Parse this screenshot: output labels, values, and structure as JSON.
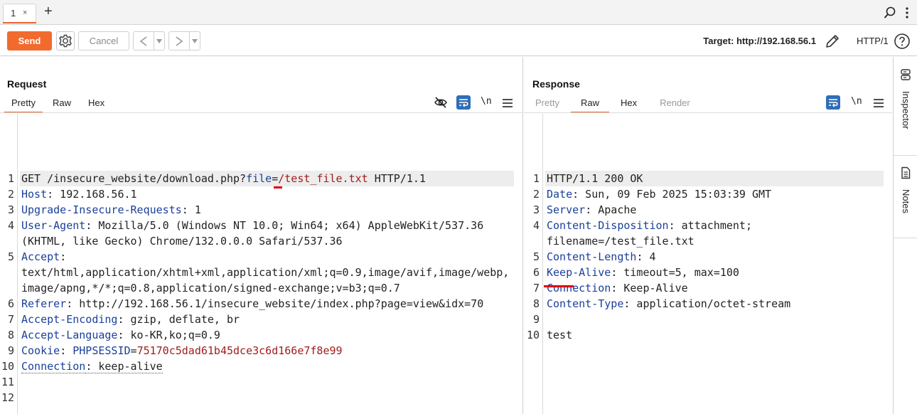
{
  "tabs": [
    {
      "label": "1",
      "close": "×"
    }
  ],
  "new_tab": "+",
  "toolbar": {
    "send_label": "Send",
    "cancel_label": "Cancel",
    "back_label": "<",
    "forward_label": ">",
    "drop_label": "▾",
    "target_label": "Target: http://192.168.56.1",
    "http_version": "HTTP/1"
  },
  "request": {
    "title": "Request",
    "tabs": [
      "Pretty",
      "Raw",
      "Hex"
    ],
    "active_tab": "Pretty",
    "newline_toggle": "\\n",
    "lines": [
      {
        "n": "1",
        "parts": [
          [
            "v",
            "GET /insecure_website/download.php?"
          ],
          [
            "param",
            "file"
          ],
          [
            "v",
            "="
          ],
          [
            "pval",
            "/test_file.txt"
          ],
          [
            "v",
            " HTTP/1.1"
          ]
        ],
        "hl": true
      },
      {
        "n": "2",
        "parts": [
          [
            "k",
            "Host"
          ],
          [
            "v",
            ": 192.168.56.1"
          ]
        ]
      },
      {
        "n": "3",
        "parts": [
          [
            "k",
            "Upgrade-Insecure-Requests"
          ],
          [
            "v",
            ": 1"
          ]
        ]
      },
      {
        "n": "4",
        "parts": [
          [
            "k",
            "User-Agent"
          ],
          [
            "v",
            ": Mozilla/5.0 (Windows NT 10.0; Win64; x64) AppleWebKit/537.36"
          ]
        ]
      },
      {
        "n": "",
        "parts": [
          [
            "v",
            "(KHTML, like Gecko) Chrome/132.0.0.0 Safari/537.36"
          ]
        ]
      },
      {
        "n": "5",
        "parts": [
          [
            "k",
            "Accept"
          ],
          [
            "v",
            ":"
          ]
        ]
      },
      {
        "n": "",
        "parts": [
          [
            "v",
            "text/html,application/xhtml+xml,application/xml;q=0.9,image/avif,image/webp,"
          ]
        ]
      },
      {
        "n": "",
        "parts": [
          [
            "v",
            "image/apng,*/*;q=0.8,application/signed-exchange;v=b3;q=0.7"
          ]
        ]
      },
      {
        "n": "6",
        "parts": [
          [
            "k",
            "Referer"
          ],
          [
            "v",
            ": http://192.168.56.1/insecure_website/index.php?page=view&idx=70"
          ]
        ]
      },
      {
        "n": "7",
        "parts": [
          [
            "k",
            "Accept-Encoding"
          ],
          [
            "v",
            ": gzip, deflate, br"
          ]
        ]
      },
      {
        "n": "8",
        "parts": [
          [
            "k",
            "Accept-Language"
          ],
          [
            "v",
            ": ko-KR,ko;q=0.9"
          ]
        ]
      },
      {
        "n": "9",
        "parts": [
          [
            "k",
            "Cookie"
          ],
          [
            "v",
            ": "
          ],
          [
            "param",
            "PHPSESSID"
          ],
          [
            "v",
            "="
          ],
          [
            "pval",
            "75170c5dad61b45dce3c6d166e7f8e99"
          ]
        ]
      },
      {
        "n": "10",
        "parts": [
          [
            "kd",
            "Connection"
          ],
          [
            "vd",
            ": keep-alive"
          ]
        ]
      },
      {
        "n": "11",
        "parts": []
      },
      {
        "n": "12",
        "parts": []
      }
    ]
  },
  "response": {
    "title": "Response",
    "tabs": [
      "Pretty",
      "Raw",
      "Hex",
      "Render"
    ],
    "active_tab": "Raw",
    "newline_toggle": "\\n",
    "lines": [
      {
        "n": "1",
        "parts": [
          [
            "v",
            "HTTP/1.1 200 OK"
          ]
        ],
        "hl": true
      },
      {
        "n": "2",
        "parts": [
          [
            "k",
            "Date"
          ],
          [
            "v",
            ": Sun, 09 Feb 2025 15:03:39 GMT"
          ]
        ]
      },
      {
        "n": "3",
        "parts": [
          [
            "k",
            "Server"
          ],
          [
            "v",
            ": Apache"
          ]
        ]
      },
      {
        "n": "4",
        "parts": [
          [
            "k",
            "Content-Disposition"
          ],
          [
            "v",
            ": attachment;"
          ]
        ]
      },
      {
        "n": "",
        "parts": [
          [
            "v",
            "filename=/test_file.txt"
          ]
        ]
      },
      {
        "n": "5",
        "parts": [
          [
            "k",
            "Content-Length"
          ],
          [
            "v",
            ": 4"
          ]
        ]
      },
      {
        "n": "6",
        "parts": [
          [
            "k",
            "Keep-Alive"
          ],
          [
            "v",
            ": timeout=5, max=100"
          ]
        ]
      },
      {
        "n": "7",
        "parts": [
          [
            "k",
            "Connection"
          ],
          [
            "v",
            ": Keep-Alive"
          ]
        ]
      },
      {
        "n": "8",
        "parts": [
          [
            "k",
            "Content-Type"
          ],
          [
            "v",
            ": application/octet-stream"
          ]
        ]
      },
      {
        "n": "9",
        "parts": []
      },
      {
        "n": "10",
        "parts": [
          [
            "v",
            "test"
          ]
        ]
      }
    ]
  },
  "sidebar": {
    "inspector_label": "Inspector",
    "notes_label": "Notes"
  },
  "colors": {
    "accent": "#f26a2e",
    "header_key": "#1a3f9a",
    "param_value": "#a11c1c",
    "highlight_red": "#e00000",
    "toggle_blue": "#2f6eb8"
  }
}
